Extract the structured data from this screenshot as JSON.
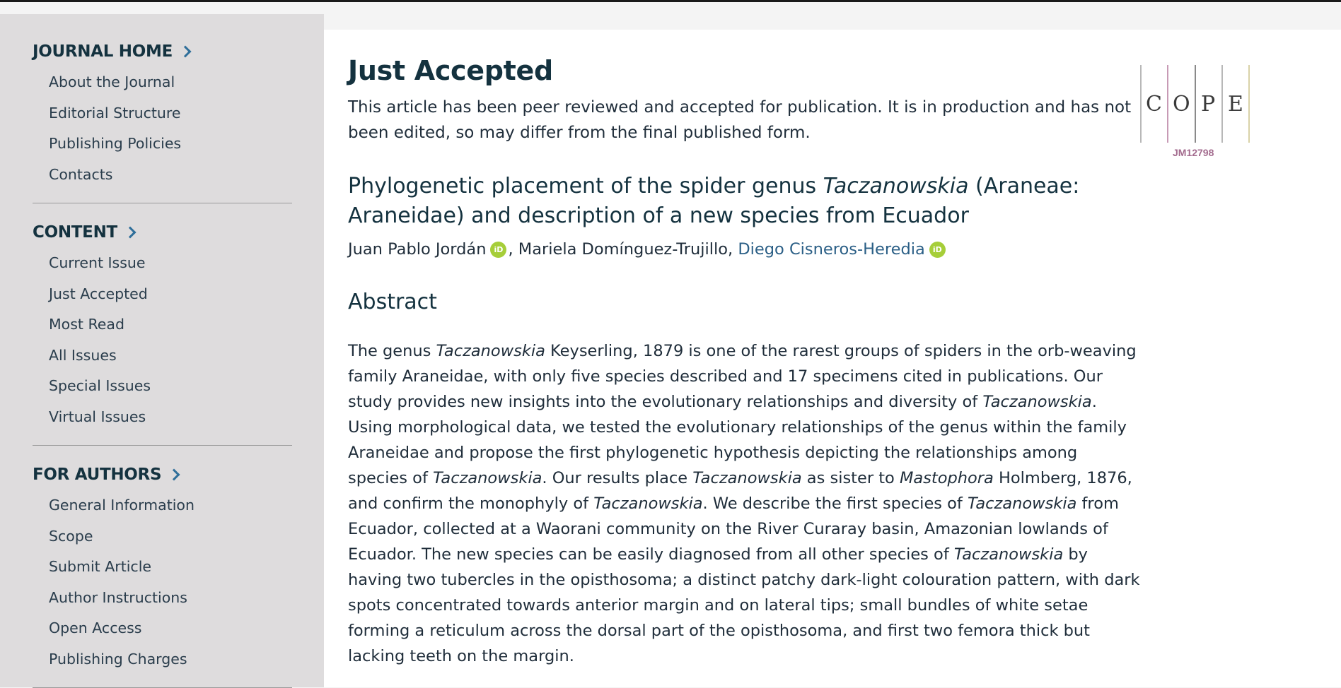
{
  "sidebar": {
    "sections": [
      {
        "title": "JOURNAL HOME",
        "items": [
          "About the Journal",
          "Editorial Structure",
          "Publishing Policies",
          "Contacts"
        ]
      },
      {
        "title": "CONTENT",
        "items": [
          "Current Issue",
          "Just Accepted",
          "Most Read",
          "All Issues",
          "Special Issues",
          "Virtual Issues"
        ]
      },
      {
        "title": "FOR AUTHORS",
        "items": [
          "General Information",
          "Scope",
          "Submit Article",
          "Author Instructions",
          "Open Access",
          "Publishing Charges"
        ]
      }
    ]
  },
  "main": {
    "heading": "Just Accepted",
    "notice": "This article has been peer reviewed and accepted for publication. It is in production and has not been edited, so may differ from the final published form.",
    "article": {
      "title_pre": "Phylogenetic placement of the spider genus ",
      "title_italic": "Taczanowskia",
      "title_post": " (Araneae: Araneidae) and description of a new species from Ecuador",
      "authors": {
        "a1": "Juan Pablo Jordán",
        "a2": ", Mariela Domínguez-Trujillo, ",
        "a3": "Diego Cisneros-Heredia",
        "orcid_label": "iD"
      }
    },
    "abstract_heading": "Abstract",
    "abstract": {
      "s1": "The genus ",
      "i1": "Taczanowskia",
      "s2": " Keyserling, 1879 is one of the rarest groups of spiders in the orb-weaving family Araneidae, with only five species described and 17 specimens cited in publications. Our study provides new insights into the evolutionary relationships and diversity of ",
      "i2": "Taczanowskia",
      "s3": ". Using morphological data, we tested the evolutionary relationships of the genus within the family Araneidae and propose the first phylogenetic hypothesis depicting the relationships among species of ",
      "i3": "Taczanowskia",
      "s4": ". Our results place ",
      "i4": "Taczanowskia",
      "s5": " as sister to ",
      "i5": "Mastophora",
      "s6": " Holmberg, 1876, and confirm the monophyly of ",
      "i6": "Taczanowskia",
      "s7": ". We describe the first species of ",
      "i7": "Taczanowskia",
      "s8": " from Ecuador, collected at a Waorani community on the River Curaray basin, Amazonian lowlands of Ecuador. The new species can be easily diagnosed from all other species of ",
      "i8": "Taczanowskia",
      "s9": " by having two tubercles in the opisthosoma; a distinct patchy dark-light colouration pattern, with dark spots concentrated towards anterior margin and on lateral tips; small bundles of white setae forming a reticulum across the dorsal part of the opisthosoma, and first two femora thick but lacking teeth on the margin."
    }
  },
  "cope": {
    "letters": [
      "C",
      "O",
      "P",
      "E"
    ],
    "code": "JM12798",
    "bar_colors": [
      "#b8b8b8",
      "#c79ab5",
      "#8a8a8a",
      "#b8b8b8",
      "#d9d2a8"
    ]
  },
  "colors": {
    "link": "#2b5f86",
    "orcid": "#a6ce39",
    "heading": "#14323f"
  }
}
